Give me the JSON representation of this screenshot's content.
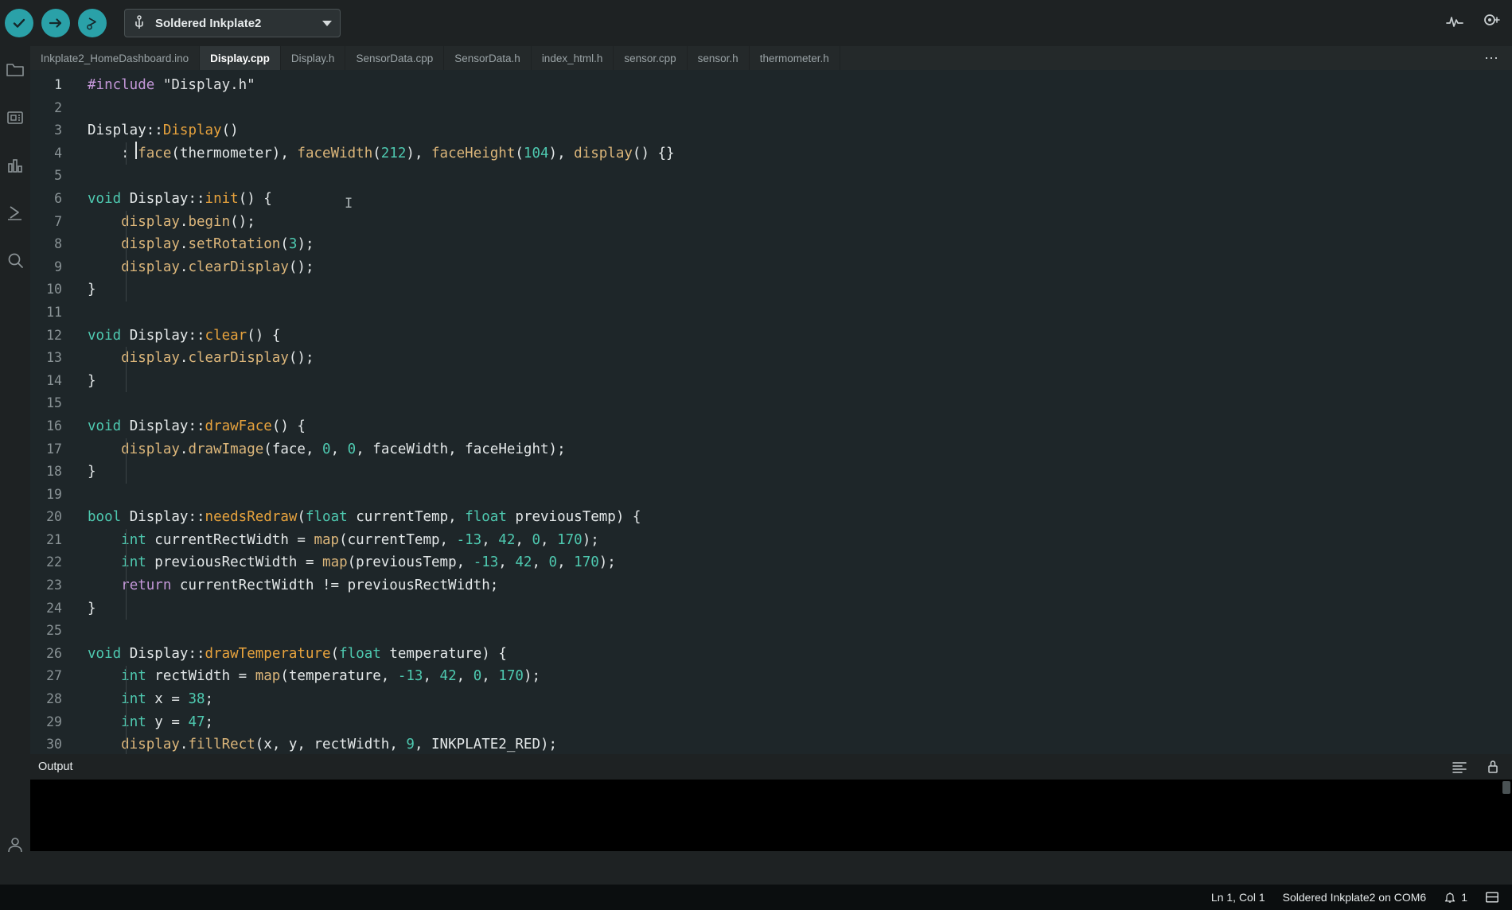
{
  "toolbar": {
    "verify_label": "Verify",
    "upload_label": "Upload",
    "debug_label": "Debug",
    "board_selector": {
      "value": "Soldered Inkplate2",
      "icon": "usb-icon",
      "caret": "chevron-down-icon"
    },
    "right_icons": [
      {
        "name": "serial-plotter-icon",
        "label": "Serial Plotter"
      },
      {
        "name": "serial-monitor-icon",
        "label": "Serial Monitor"
      }
    ],
    "accent_color": "#2aa1a8"
  },
  "activity_bar": {
    "items": [
      {
        "name": "sketchbook-icon",
        "label": "Sketchbook"
      },
      {
        "name": "boards-manager-icon",
        "label": "Boards Manager"
      },
      {
        "name": "library-manager-icon",
        "label": "Library Manager"
      },
      {
        "name": "debug-icon",
        "label": "Debug"
      },
      {
        "name": "search-icon",
        "label": "Search"
      }
    ],
    "bottom_items": [
      {
        "name": "account-icon",
        "label": "Account"
      }
    ]
  },
  "tabs": {
    "items": [
      {
        "label": "Inkplate2_HomeDashboard.ino",
        "active": false
      },
      {
        "label": "Display.cpp",
        "active": true
      },
      {
        "label": "Display.h",
        "active": false
      },
      {
        "label": "SensorData.cpp",
        "active": false
      },
      {
        "label": "SensorData.h",
        "active": false
      },
      {
        "label": "index_html.h",
        "active": false
      },
      {
        "label": "sensor.cpp",
        "active": false
      },
      {
        "label": "sensor.h",
        "active": false
      },
      {
        "label": "thermometer.h",
        "active": false
      }
    ],
    "overflow_label": "⋯"
  },
  "editor": {
    "filename": "Display.cpp",
    "first_line": 1,
    "lines": [
      {
        "n": 1,
        "tokens": [
          {
            "t": "#include ",
            "c": "t-pre"
          },
          {
            "t": "\"Display.h\"",
            "c": "t-str"
          }
        ]
      },
      {
        "n": 2,
        "tokens": []
      },
      {
        "n": 3,
        "tokens": [
          {
            "t": "Display",
            "c": "t-id"
          },
          {
            "t": "::",
            "c": "t-punc"
          },
          {
            "t": "Display",
            "c": "t-fno"
          },
          {
            "t": "()",
            "c": "t-punc"
          }
        ]
      },
      {
        "n": 4,
        "tokens": [
          {
            "t": "    : ",
            "c": "t-punc"
          },
          {
            "t": "face",
            "c": "t-fn"
          },
          {
            "t": "(thermometer), ",
            "c": "t-punc"
          },
          {
            "t": "faceWidth",
            "c": "t-fn"
          },
          {
            "t": "(",
            "c": "t-punc"
          },
          {
            "t": "212",
            "c": "t-num"
          },
          {
            "t": "), ",
            "c": "t-punc"
          },
          {
            "t": "faceHeight",
            "c": "t-fn"
          },
          {
            "t": "(",
            "c": "t-punc"
          },
          {
            "t": "104",
            "c": "t-num"
          },
          {
            "t": "), ",
            "c": "t-punc"
          },
          {
            "t": "display",
            "c": "t-fn"
          },
          {
            "t": "() {}",
            "c": "t-punc"
          }
        ]
      },
      {
        "n": 5,
        "tokens": []
      },
      {
        "n": 6,
        "tokens": [
          {
            "t": "void",
            "c": "t-kw"
          },
          {
            "t": " Display",
            "c": "t-id"
          },
          {
            "t": "::",
            "c": "t-punc"
          },
          {
            "t": "init",
            "c": "t-fno"
          },
          {
            "t": "() {",
            "c": "t-punc"
          }
        ]
      },
      {
        "n": 7,
        "tokens": [
          {
            "t": "    display",
            "c": "t-fn"
          },
          {
            "t": ".",
            "c": "t-punc"
          },
          {
            "t": "begin",
            "c": "t-fn"
          },
          {
            "t": "();",
            "c": "t-punc"
          }
        ]
      },
      {
        "n": 8,
        "tokens": [
          {
            "t": "    display",
            "c": "t-fn"
          },
          {
            "t": ".",
            "c": "t-punc"
          },
          {
            "t": "setRotation",
            "c": "t-fn"
          },
          {
            "t": "(",
            "c": "t-punc"
          },
          {
            "t": "3",
            "c": "t-num"
          },
          {
            "t": ");",
            "c": "t-punc"
          }
        ]
      },
      {
        "n": 9,
        "tokens": [
          {
            "t": "    display",
            "c": "t-fn"
          },
          {
            "t": ".",
            "c": "t-punc"
          },
          {
            "t": "clearDisplay",
            "c": "t-fn"
          },
          {
            "t": "();",
            "c": "t-punc"
          }
        ]
      },
      {
        "n": 10,
        "tokens": [
          {
            "t": "}",
            "c": "t-punc"
          }
        ]
      },
      {
        "n": 11,
        "tokens": []
      },
      {
        "n": 12,
        "tokens": [
          {
            "t": "void",
            "c": "t-kw"
          },
          {
            "t": " Display",
            "c": "t-id"
          },
          {
            "t": "::",
            "c": "t-punc"
          },
          {
            "t": "clear",
            "c": "t-fno"
          },
          {
            "t": "() {",
            "c": "t-punc"
          }
        ]
      },
      {
        "n": 13,
        "tokens": [
          {
            "t": "    display",
            "c": "t-fn"
          },
          {
            "t": ".",
            "c": "t-punc"
          },
          {
            "t": "clearDisplay",
            "c": "t-fn"
          },
          {
            "t": "();",
            "c": "t-punc"
          }
        ]
      },
      {
        "n": 14,
        "tokens": [
          {
            "t": "}",
            "c": "t-punc"
          }
        ]
      },
      {
        "n": 15,
        "tokens": []
      },
      {
        "n": 16,
        "tokens": [
          {
            "t": "void",
            "c": "t-kw"
          },
          {
            "t": " Display",
            "c": "t-id"
          },
          {
            "t": "::",
            "c": "t-punc"
          },
          {
            "t": "drawFace",
            "c": "t-fno"
          },
          {
            "t": "() {",
            "c": "t-punc"
          }
        ]
      },
      {
        "n": 17,
        "tokens": [
          {
            "t": "    display",
            "c": "t-fn"
          },
          {
            "t": ".",
            "c": "t-punc"
          },
          {
            "t": "drawImage",
            "c": "t-fn"
          },
          {
            "t": "(face, ",
            "c": "t-punc"
          },
          {
            "t": "0",
            "c": "t-num"
          },
          {
            "t": ", ",
            "c": "t-punc"
          },
          {
            "t": "0",
            "c": "t-num"
          },
          {
            "t": ", faceWidth, faceHeight);",
            "c": "t-punc"
          }
        ]
      },
      {
        "n": 18,
        "tokens": [
          {
            "t": "}",
            "c": "t-punc"
          }
        ]
      },
      {
        "n": 19,
        "tokens": []
      },
      {
        "n": 20,
        "tokens": [
          {
            "t": "bool",
            "c": "t-kw"
          },
          {
            "t": " Display",
            "c": "t-id"
          },
          {
            "t": "::",
            "c": "t-punc"
          },
          {
            "t": "needsRedraw",
            "c": "t-fno"
          },
          {
            "t": "(",
            "c": "t-punc"
          },
          {
            "t": "float",
            "c": "t-type"
          },
          {
            "t": " currentTemp, ",
            "c": "t-punc"
          },
          {
            "t": "float",
            "c": "t-type"
          },
          {
            "t": " previousTemp) {",
            "c": "t-punc"
          }
        ]
      },
      {
        "n": 21,
        "tokens": [
          {
            "t": "    ",
            "c": "t-punc"
          },
          {
            "t": "int",
            "c": "t-type"
          },
          {
            "t": " currentRectWidth = ",
            "c": "t-punc"
          },
          {
            "t": "map",
            "c": "t-fn"
          },
          {
            "t": "(currentTemp, ",
            "c": "t-punc"
          },
          {
            "t": "-13",
            "c": "t-num"
          },
          {
            "t": ", ",
            "c": "t-punc"
          },
          {
            "t": "42",
            "c": "t-num"
          },
          {
            "t": ", ",
            "c": "t-punc"
          },
          {
            "t": "0",
            "c": "t-num"
          },
          {
            "t": ", ",
            "c": "t-punc"
          },
          {
            "t": "170",
            "c": "t-num"
          },
          {
            "t": ");",
            "c": "t-punc"
          }
        ]
      },
      {
        "n": 22,
        "tokens": [
          {
            "t": "    ",
            "c": "t-punc"
          },
          {
            "t": "int",
            "c": "t-type"
          },
          {
            "t": " previousRectWidth = ",
            "c": "t-punc"
          },
          {
            "t": "map",
            "c": "t-fn"
          },
          {
            "t": "(previousTemp, ",
            "c": "t-punc"
          },
          {
            "t": "-13",
            "c": "t-num"
          },
          {
            "t": ", ",
            "c": "t-punc"
          },
          {
            "t": "42",
            "c": "t-num"
          },
          {
            "t": ", ",
            "c": "t-punc"
          },
          {
            "t": "0",
            "c": "t-num"
          },
          {
            "t": ", ",
            "c": "t-punc"
          },
          {
            "t": "170",
            "c": "t-num"
          },
          {
            "t": ");",
            "c": "t-punc"
          }
        ]
      },
      {
        "n": 23,
        "tokens": [
          {
            "t": "    ",
            "c": "t-punc"
          },
          {
            "t": "return",
            "c": "t-ret"
          },
          {
            "t": " currentRectWidth != previousRectWidth;",
            "c": "t-punc"
          }
        ]
      },
      {
        "n": 24,
        "tokens": [
          {
            "t": "}",
            "c": "t-punc"
          }
        ]
      },
      {
        "n": 25,
        "tokens": []
      },
      {
        "n": 26,
        "tokens": [
          {
            "t": "void",
            "c": "t-kw"
          },
          {
            "t": " Display",
            "c": "t-id"
          },
          {
            "t": "::",
            "c": "t-punc"
          },
          {
            "t": "drawTemperature",
            "c": "t-fno"
          },
          {
            "t": "(",
            "c": "t-punc"
          },
          {
            "t": "float",
            "c": "t-type"
          },
          {
            "t": " temperature) {",
            "c": "t-punc"
          }
        ]
      },
      {
        "n": 27,
        "tokens": [
          {
            "t": "    ",
            "c": "t-punc"
          },
          {
            "t": "int",
            "c": "t-type"
          },
          {
            "t": " rectWidth = ",
            "c": "t-punc"
          },
          {
            "t": "map",
            "c": "t-fn"
          },
          {
            "t": "(temperature, ",
            "c": "t-punc"
          },
          {
            "t": "-13",
            "c": "t-num"
          },
          {
            "t": ", ",
            "c": "t-punc"
          },
          {
            "t": "42",
            "c": "t-num"
          },
          {
            "t": ", ",
            "c": "t-punc"
          },
          {
            "t": "0",
            "c": "t-num"
          },
          {
            "t": ", ",
            "c": "t-punc"
          },
          {
            "t": "170",
            "c": "t-num"
          },
          {
            "t": ");",
            "c": "t-punc"
          }
        ]
      },
      {
        "n": 28,
        "tokens": [
          {
            "t": "    ",
            "c": "t-punc"
          },
          {
            "t": "int",
            "c": "t-type"
          },
          {
            "t": " x = ",
            "c": "t-punc"
          },
          {
            "t": "38",
            "c": "t-num"
          },
          {
            "t": ";",
            "c": "t-punc"
          }
        ]
      },
      {
        "n": 29,
        "tokens": [
          {
            "t": "    ",
            "c": "t-punc"
          },
          {
            "t": "int",
            "c": "t-type"
          },
          {
            "t": " y = ",
            "c": "t-punc"
          },
          {
            "t": "47",
            "c": "t-num"
          },
          {
            "t": ";",
            "c": "t-punc"
          }
        ]
      },
      {
        "n": 30,
        "tokens": [
          {
            "t": "    display",
            "c": "t-fn"
          },
          {
            "t": ".",
            "c": "t-punc"
          },
          {
            "t": "fillRect",
            "c": "t-fn"
          },
          {
            "t": "(x, y, rectWidth, ",
            "c": "t-punc"
          },
          {
            "t": "9",
            "c": "t-num"
          },
          {
            "t": ", INKPLATE2_RED);",
            "c": "t-punc"
          }
        ]
      }
    ]
  },
  "output": {
    "title": "Output",
    "body_text": "",
    "actions": [
      {
        "name": "clear-output-icon",
        "label": "Clear Output"
      },
      {
        "name": "toggle-autoscroll-icon",
        "label": "Toggle Autoscroll"
      }
    ]
  },
  "statusbar": {
    "cursor_position": "Ln 1, Col 1",
    "board_port": "Soldered Inkplate2 on COM6",
    "notification_count": "1",
    "notification_icon": "bell-icon",
    "panel_icon": "toggle-panel-icon"
  }
}
